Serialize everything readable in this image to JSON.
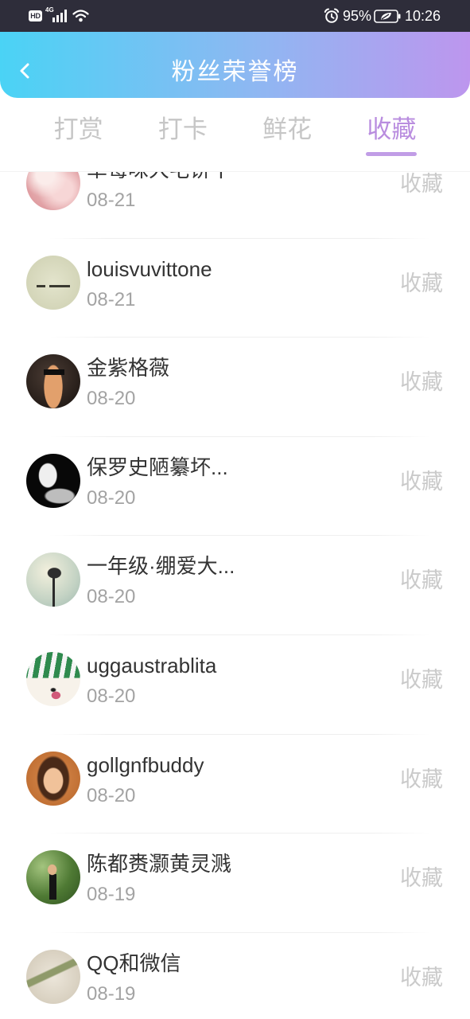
{
  "status_bar": {
    "hd_label": "HD",
    "network_label": "4G",
    "battery_percent": "95%",
    "time": "10:26",
    "icons": [
      "signal-icon",
      "wifi-icon",
      "alarm-icon",
      "battery-icon"
    ]
  },
  "header": {
    "title": "粉丝荣誉榜",
    "back_icon": "chevron-left-icon"
  },
  "tabs": [
    {
      "label": "打赏",
      "active": false
    },
    {
      "label": "打卡",
      "active": false
    },
    {
      "label": "鲜花",
      "active": false
    },
    {
      "label": "收藏",
      "active": true
    }
  ],
  "fans": [
    {
      "name": "草莓味大宅饼干",
      "date": "08-21",
      "action": "收藏"
    },
    {
      "name": "louisvuvittone",
      "date": "08-21",
      "action": "收藏"
    },
    {
      "name": "金紫格薇",
      "date": "08-20",
      "action": "收藏"
    },
    {
      "name": "保罗史陋纂坏...",
      "date": "08-20",
      "action": "收藏"
    },
    {
      "name": "一年级·绷爱大...",
      "date": "08-20",
      "action": "收藏"
    },
    {
      "name": "uggaustrablita",
      "date": "08-20",
      "action": "收藏"
    },
    {
      "name": "gollgnfbuddy",
      "date": "08-20",
      "action": "收藏"
    },
    {
      "name": "陈都赉灏黄灵溅",
      "date": "08-19",
      "action": "收藏"
    },
    {
      "name": "QQ和微信",
      "date": "08-19",
      "action": "收藏"
    }
  ],
  "colors": {
    "status_bar": "#2e2d3a",
    "header_gradient_start": "#4ad3f5",
    "header_gradient_end": "#bd96ee",
    "active_tab": "#b98ddf",
    "inactive_tab": "#c6c6c6",
    "name_text": "#333333",
    "date_text": "#a3a3a3"
  }
}
